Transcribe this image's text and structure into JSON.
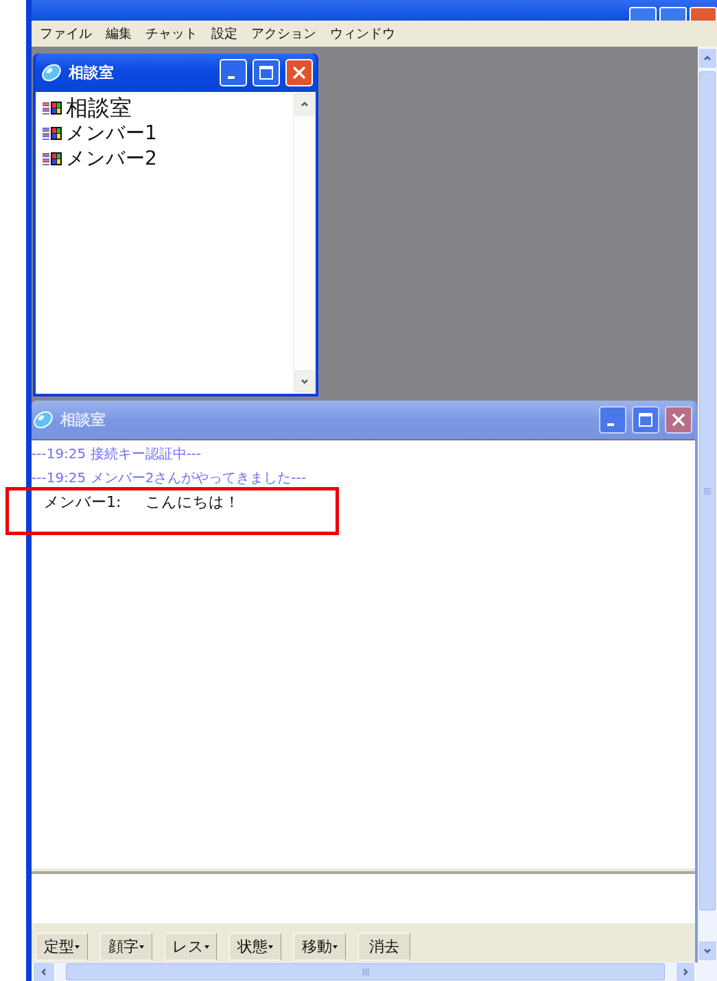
{
  "menu": [
    {
      "label": "ファイル"
    },
    {
      "label": "編集"
    },
    {
      "label": "チャット"
    },
    {
      "label": "設定"
    },
    {
      "label": "アクション"
    },
    {
      "label": "ウィンドウ"
    }
  ],
  "member_window": {
    "title": "相談室",
    "active": true,
    "items": [
      {
        "label": "相談室",
        "kind": "room"
      },
      {
        "label": "メンバー1",
        "kind": "member"
      },
      {
        "label": "メンバー2",
        "kind": "member"
      }
    ]
  },
  "chat_window": {
    "title": "相談室",
    "active": false,
    "log": [
      {
        "kind": "system",
        "text": "---19:25  接続キー認証中---"
      },
      {
        "kind": "system",
        "text": "---19:25  メンバー2さんがやってきました---"
      },
      {
        "kind": "message",
        "speaker": "メンバー1:",
        "text": "こんにちは！"
      }
    ],
    "toolbar": [
      {
        "label": "定型",
        "dropdown": true
      },
      {
        "label": "顔字",
        "dropdown": true
      },
      {
        "label": "レス",
        "dropdown": true
      },
      {
        "label": "状態",
        "dropdown": true
      },
      {
        "label": "移動",
        "dropdown": true
      },
      {
        "label": "消去",
        "dropdown": false
      }
    ]
  }
}
